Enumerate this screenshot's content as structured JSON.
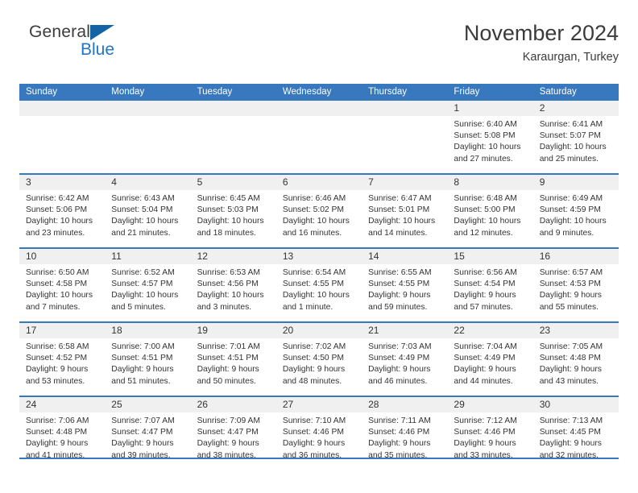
{
  "brand": {
    "name_part1": "General",
    "name_part2": "Blue",
    "color_dark": "#3c3c3c",
    "color_blue": "#2176c7",
    "triangle_color": "#1464a5"
  },
  "header": {
    "title": "November 2024",
    "subtitle": "Karaurgan, Turkey"
  },
  "theme": {
    "header_bar_color": "#3778be",
    "row_divider_color": "#3778be",
    "day_band_color": "#f0f0f0",
    "text_color": "#333333"
  },
  "weekdays": [
    {
      "label": "Sunday"
    },
    {
      "label": "Monday"
    },
    {
      "label": "Tuesday"
    },
    {
      "label": "Wednesday"
    },
    {
      "label": "Thursday"
    },
    {
      "label": "Friday"
    },
    {
      "label": "Saturday"
    }
  ],
  "weeks": [
    {
      "days": [
        {
          "num": "",
          "sunrise": "",
          "sunset": "",
          "daylight": "",
          "empty": true
        },
        {
          "num": "",
          "sunrise": "",
          "sunset": "",
          "daylight": "",
          "empty": true
        },
        {
          "num": "",
          "sunrise": "",
          "sunset": "",
          "daylight": "",
          "empty": true
        },
        {
          "num": "",
          "sunrise": "",
          "sunset": "",
          "daylight": "",
          "empty": true
        },
        {
          "num": "",
          "sunrise": "",
          "sunset": "",
          "daylight": "",
          "empty": true
        },
        {
          "num": "1",
          "sunrise": "Sunrise: 6:40 AM",
          "sunset": "Sunset: 5:08 PM",
          "daylight": "Daylight: 10 hours and 27 minutes.",
          "empty": false
        },
        {
          "num": "2",
          "sunrise": "Sunrise: 6:41 AM",
          "sunset": "Sunset: 5:07 PM",
          "daylight": "Daylight: 10 hours and 25 minutes.",
          "empty": false
        }
      ]
    },
    {
      "days": [
        {
          "num": "3",
          "sunrise": "Sunrise: 6:42 AM",
          "sunset": "Sunset: 5:06 PM",
          "daylight": "Daylight: 10 hours and 23 minutes.",
          "empty": false
        },
        {
          "num": "4",
          "sunrise": "Sunrise: 6:43 AM",
          "sunset": "Sunset: 5:04 PM",
          "daylight": "Daylight: 10 hours and 21 minutes.",
          "empty": false
        },
        {
          "num": "5",
          "sunrise": "Sunrise: 6:45 AM",
          "sunset": "Sunset: 5:03 PM",
          "daylight": "Daylight: 10 hours and 18 minutes.",
          "empty": false
        },
        {
          "num": "6",
          "sunrise": "Sunrise: 6:46 AM",
          "sunset": "Sunset: 5:02 PM",
          "daylight": "Daylight: 10 hours and 16 minutes.",
          "empty": false
        },
        {
          "num": "7",
          "sunrise": "Sunrise: 6:47 AM",
          "sunset": "Sunset: 5:01 PM",
          "daylight": "Daylight: 10 hours and 14 minutes.",
          "empty": false
        },
        {
          "num": "8",
          "sunrise": "Sunrise: 6:48 AM",
          "sunset": "Sunset: 5:00 PM",
          "daylight": "Daylight: 10 hours and 12 minutes.",
          "empty": false
        },
        {
          "num": "9",
          "sunrise": "Sunrise: 6:49 AM",
          "sunset": "Sunset: 4:59 PM",
          "daylight": "Daylight: 10 hours and 9 minutes.",
          "empty": false
        }
      ]
    },
    {
      "days": [
        {
          "num": "10",
          "sunrise": "Sunrise: 6:50 AM",
          "sunset": "Sunset: 4:58 PM",
          "daylight": "Daylight: 10 hours and 7 minutes.",
          "empty": false
        },
        {
          "num": "11",
          "sunrise": "Sunrise: 6:52 AM",
          "sunset": "Sunset: 4:57 PM",
          "daylight": "Daylight: 10 hours and 5 minutes.",
          "empty": false
        },
        {
          "num": "12",
          "sunrise": "Sunrise: 6:53 AM",
          "sunset": "Sunset: 4:56 PM",
          "daylight": "Daylight: 10 hours and 3 minutes.",
          "empty": false
        },
        {
          "num": "13",
          "sunrise": "Sunrise: 6:54 AM",
          "sunset": "Sunset: 4:55 PM",
          "daylight": "Daylight: 10 hours and 1 minute.",
          "empty": false
        },
        {
          "num": "14",
          "sunrise": "Sunrise: 6:55 AM",
          "sunset": "Sunset: 4:55 PM",
          "daylight": "Daylight: 9 hours and 59 minutes.",
          "empty": false
        },
        {
          "num": "15",
          "sunrise": "Sunrise: 6:56 AM",
          "sunset": "Sunset: 4:54 PM",
          "daylight": "Daylight: 9 hours and 57 minutes.",
          "empty": false
        },
        {
          "num": "16",
          "sunrise": "Sunrise: 6:57 AM",
          "sunset": "Sunset: 4:53 PM",
          "daylight": "Daylight: 9 hours and 55 minutes.",
          "empty": false
        }
      ]
    },
    {
      "days": [
        {
          "num": "17",
          "sunrise": "Sunrise: 6:58 AM",
          "sunset": "Sunset: 4:52 PM",
          "daylight": "Daylight: 9 hours and 53 minutes.",
          "empty": false
        },
        {
          "num": "18",
          "sunrise": "Sunrise: 7:00 AM",
          "sunset": "Sunset: 4:51 PM",
          "daylight": "Daylight: 9 hours and 51 minutes.",
          "empty": false
        },
        {
          "num": "19",
          "sunrise": "Sunrise: 7:01 AM",
          "sunset": "Sunset: 4:51 PM",
          "daylight": "Daylight: 9 hours and 50 minutes.",
          "empty": false
        },
        {
          "num": "20",
          "sunrise": "Sunrise: 7:02 AM",
          "sunset": "Sunset: 4:50 PM",
          "daylight": "Daylight: 9 hours and 48 minutes.",
          "empty": false
        },
        {
          "num": "21",
          "sunrise": "Sunrise: 7:03 AM",
          "sunset": "Sunset: 4:49 PM",
          "daylight": "Daylight: 9 hours and 46 minutes.",
          "empty": false
        },
        {
          "num": "22",
          "sunrise": "Sunrise: 7:04 AM",
          "sunset": "Sunset: 4:49 PM",
          "daylight": "Daylight: 9 hours and 44 minutes.",
          "empty": false
        },
        {
          "num": "23",
          "sunrise": "Sunrise: 7:05 AM",
          "sunset": "Sunset: 4:48 PM",
          "daylight": "Daylight: 9 hours and 43 minutes.",
          "empty": false
        }
      ]
    },
    {
      "days": [
        {
          "num": "24",
          "sunrise": "Sunrise: 7:06 AM",
          "sunset": "Sunset: 4:48 PM",
          "daylight": "Daylight: 9 hours and 41 minutes.",
          "empty": false
        },
        {
          "num": "25",
          "sunrise": "Sunrise: 7:07 AM",
          "sunset": "Sunset: 4:47 PM",
          "daylight": "Daylight: 9 hours and 39 minutes.",
          "empty": false
        },
        {
          "num": "26",
          "sunrise": "Sunrise: 7:09 AM",
          "sunset": "Sunset: 4:47 PM",
          "daylight": "Daylight: 9 hours and 38 minutes.",
          "empty": false
        },
        {
          "num": "27",
          "sunrise": "Sunrise: 7:10 AM",
          "sunset": "Sunset: 4:46 PM",
          "daylight": "Daylight: 9 hours and 36 minutes.",
          "empty": false
        },
        {
          "num": "28",
          "sunrise": "Sunrise: 7:11 AM",
          "sunset": "Sunset: 4:46 PM",
          "daylight": "Daylight: 9 hours and 35 minutes.",
          "empty": false
        },
        {
          "num": "29",
          "sunrise": "Sunrise: 7:12 AM",
          "sunset": "Sunset: 4:46 PM",
          "daylight": "Daylight: 9 hours and 33 minutes.",
          "empty": false
        },
        {
          "num": "30",
          "sunrise": "Sunrise: 7:13 AM",
          "sunset": "Sunset: 4:45 PM",
          "daylight": "Daylight: 9 hours and 32 minutes.",
          "empty": false
        }
      ]
    }
  ]
}
